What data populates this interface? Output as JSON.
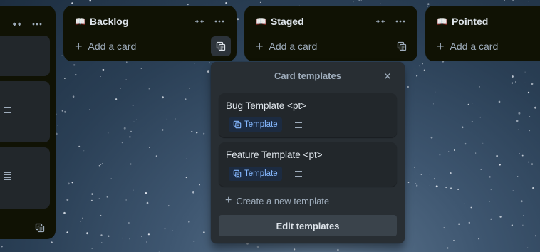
{
  "lists": [
    {
      "title": "",
      "has_title": false
    },
    {
      "title": "Backlog",
      "add_card": "Add a card"
    },
    {
      "title": "Staged",
      "add_card": "Add a card"
    },
    {
      "title": "Pointed",
      "add_card": "Add a card"
    }
  ],
  "icons": {
    "collapse": "collapse-arrows-icon",
    "more": "more-icon",
    "template": "card-template-icon",
    "book": "book-icon",
    "description": "description-icon",
    "close": "close-icon",
    "plus": "plus-icon"
  },
  "popover": {
    "title": "Card templates",
    "templates": [
      {
        "name": "Bug Template <pt>",
        "badge": "Template"
      },
      {
        "name": "Feature Template <pt>",
        "badge": "Template"
      }
    ],
    "create_label": "Create a new template",
    "edit_label": "Edit templates"
  },
  "colors": {
    "list_bg": "#101204",
    "card_bg": "#22272b",
    "popover_bg": "#282e33",
    "badge_text": "#85b8ff",
    "badge_bg": "#1c2b41"
  }
}
